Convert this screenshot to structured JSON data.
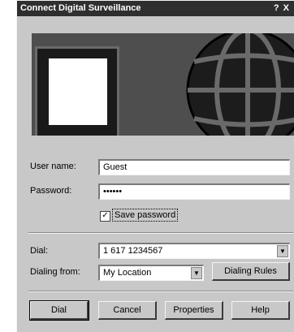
{
  "window": {
    "title": "Connect Digital Surveillance",
    "title_controls": "? X"
  },
  "form": {
    "username_label": "User name:",
    "username_value": "Guest",
    "password_label": "Password:",
    "password_value": "••••••",
    "save_password_label": "Save password",
    "save_password_checked": true,
    "dial_label": "Dial:",
    "dial_value": "1 617 1234567",
    "dialing_from_label": "Dialing from:",
    "dialing_from_value": "My Location",
    "dialing_rules_label": "Dialing Rules"
  },
  "buttons": {
    "dial": "Dial",
    "cancel": "Cancel",
    "properties": "Properties",
    "help": "Help"
  },
  "icons": {
    "checkbox_mark": "✓",
    "dropdown": "▼"
  }
}
